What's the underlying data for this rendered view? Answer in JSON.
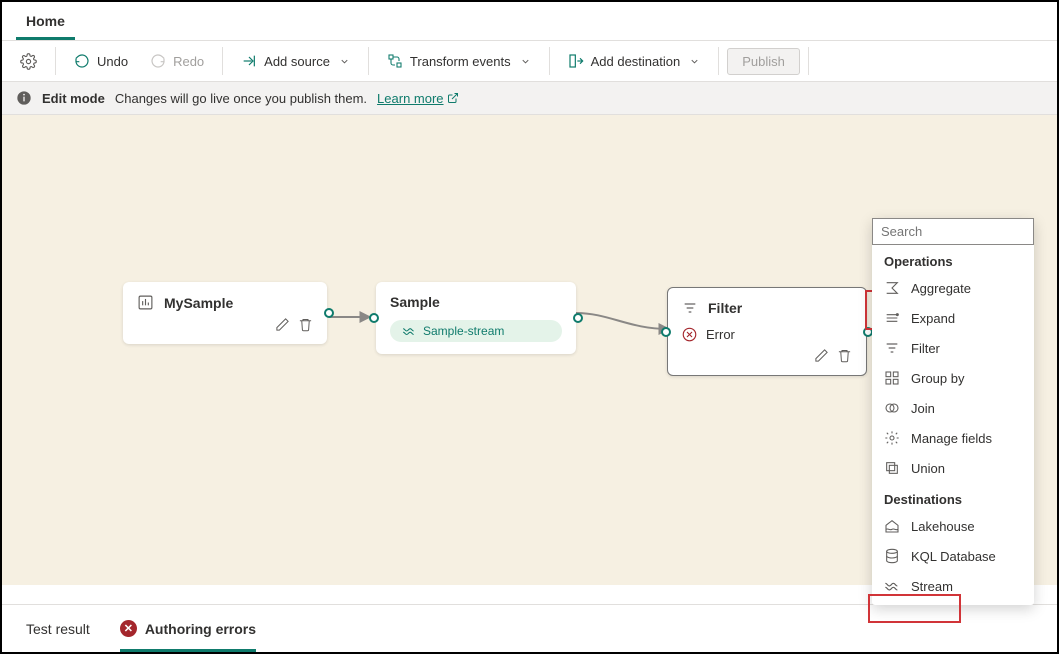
{
  "tabs": {
    "home": "Home"
  },
  "toolbar": {
    "undo": "Undo",
    "redo": "Redo",
    "add_source": "Add source",
    "transform": "Transform events",
    "add_dest": "Add destination",
    "publish": "Publish"
  },
  "info": {
    "mode": "Edit mode",
    "msg": "Changes will go live once you publish them.",
    "learn": "Learn more"
  },
  "nodes": {
    "n1": {
      "title": "MySample"
    },
    "n2": {
      "title": "Sample",
      "stream": "Sample-stream"
    },
    "n3": {
      "title": "Filter",
      "error": "Error"
    }
  },
  "dropdown": {
    "search_placeholder": "Search",
    "operations_label": "Operations",
    "operations": {
      "aggregate": "Aggregate",
      "expand": "Expand",
      "filter": "Filter",
      "groupby": "Group by",
      "join": "Join",
      "manage": "Manage fields",
      "union": "Union"
    },
    "destinations_label": "Destinations",
    "destinations": {
      "lakehouse": "Lakehouse",
      "kql": "KQL Database",
      "stream": "Stream"
    }
  },
  "bottom": {
    "test": "Test result",
    "errors": "Authoring errors"
  }
}
